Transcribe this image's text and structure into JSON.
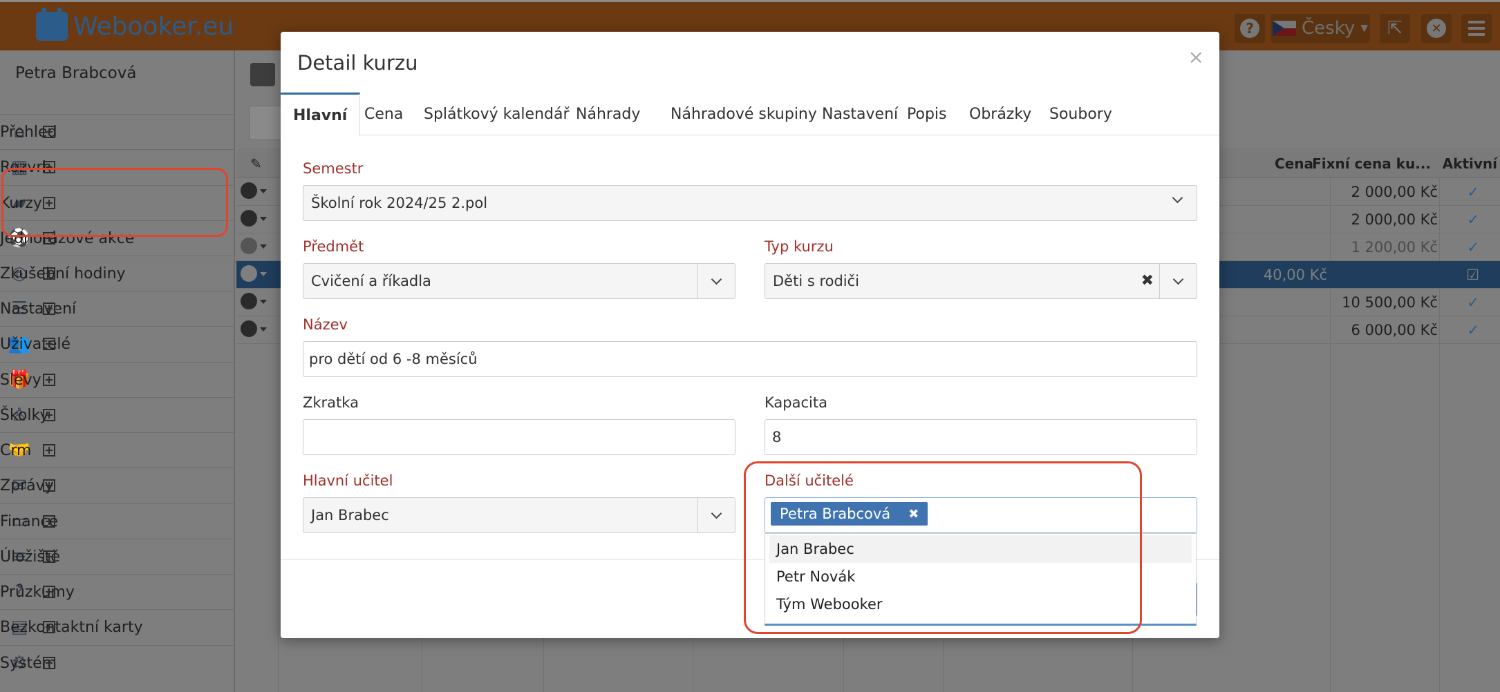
{
  "app": {
    "brand": "Webooker.eu",
    "user": "Petra Brabcová",
    "language": "Česky"
  },
  "sidebar": {
    "items": [
      {
        "label": "Přehled",
        "icon": "home-icon"
      },
      {
        "label": "Rozvrh",
        "icon": "calendar-icon"
      },
      {
        "label": "Kurzy",
        "icon": "book-icon"
      },
      {
        "label": "Jednorázové akce",
        "icon": "ball-icon"
      },
      {
        "label": "Zkušební hodiny",
        "icon": "eye-icon"
      },
      {
        "label": "Nastavení",
        "icon": "list-icon"
      },
      {
        "label": "Uživatelé",
        "icon": "users-icon"
      },
      {
        "label": "Slevy",
        "icon": "gift-icon"
      },
      {
        "label": "Školky",
        "icon": "child-icon"
      },
      {
        "label": "Crm",
        "icon": "handshake-icon"
      },
      {
        "label": "Zprávy",
        "icon": "envelope-icon"
      },
      {
        "label": "Finance",
        "icon": "money-icon"
      },
      {
        "label": "Úložiště",
        "icon": "database-icon"
      },
      {
        "label": "Průzkumy",
        "icon": "question-icon"
      },
      {
        "label": "Bezkontaktní karty",
        "icon": "card-icon"
      },
      {
        "label": "Systém",
        "icon": "cogs-icon"
      }
    ]
  },
  "bg_table": {
    "headers": {
      "cena": "Cena",
      "fixni": "Fixní cena ku...",
      "aktivni": "Aktivní"
    },
    "rows": [
      {
        "cena": "",
        "fixni": "2 000,00 Kč",
        "active": "✓"
      },
      {
        "cena": "",
        "fixni": "2 000,00 Kč",
        "active": "✓"
      },
      {
        "cena": "",
        "fixni": "1 200,00 Kč",
        "active": "✓"
      },
      {
        "cena": "40,00 Kč",
        "fixni": "",
        "active": "☑"
      },
      {
        "cena": "",
        "fixni": "10 500,00 Kč",
        "active": "✓"
      },
      {
        "cena": "",
        "fixni": "6 000,00 Kč",
        "active": "✓"
      }
    ]
  },
  "modal": {
    "title": "Detail kurzu",
    "close": "×",
    "tabs": [
      "Hlavní",
      "Cena",
      "Splátkový kalendář",
      "Náhrady",
      "Náhradové skupiny",
      "Nastavení",
      "Popis",
      "Obrázky",
      "Soubory"
    ],
    "fields": {
      "semestr": {
        "label": "Semestr",
        "value": "Školní rok 2024/25 2.pol"
      },
      "predmet": {
        "label": "Předmět",
        "value": "Cvičení a říkadla"
      },
      "typ_kurzu": {
        "label": "Typ kurzu",
        "value": "Děti s rodiči"
      },
      "nazev": {
        "label": "Název",
        "value": "pro dětí od 6 -8 měsíců"
      },
      "zkratka": {
        "label": "Zkratka",
        "value": ""
      },
      "kapacita": {
        "label": "Kapacita",
        "value": "8"
      },
      "hlavni_ucitel": {
        "label": "Hlavní učitel",
        "value": "Jan Brabec"
      },
      "dalsi_ucitele": {
        "label": "Další učitelé",
        "selected": [
          "Petra Brabcová"
        ],
        "options": [
          "Jan Brabec",
          "Petr Novák",
          "Tým Webooker"
        ]
      }
    }
  }
}
